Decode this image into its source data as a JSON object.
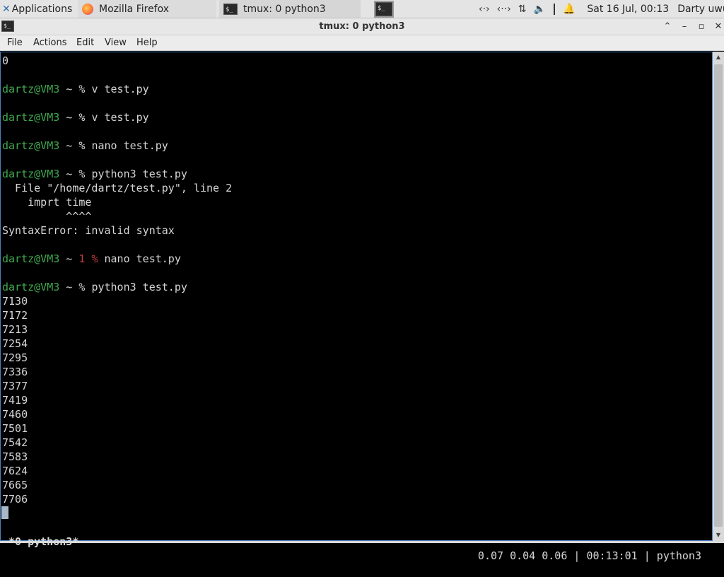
{
  "panel": {
    "applications_label": "Applications",
    "taskbar": [
      {
        "label": "Mozilla Firefox",
        "icon": "firefox-icon"
      },
      {
        "label": "tmux: 0 python3",
        "icon": "terminal-icon"
      }
    ],
    "clock": "Sat 16 Jul, 00:13",
    "user": "Darty uwu"
  },
  "window": {
    "title": "tmux: 0 python3"
  },
  "menu": [
    "File",
    "Actions",
    "Edit",
    "View",
    "Help"
  ],
  "terminal": {
    "colors": {
      "user": "#3fa84f",
      "error": "#c43c3c",
      "text": "#d6d6d6"
    },
    "lines": [
      {
        "plain": "0"
      },
      {
        "plain": ""
      },
      {
        "user": "dartz@VM3",
        "prompt": " ~ % ",
        "cmd": "v test.py"
      },
      {
        "plain": ""
      },
      {
        "user": "dartz@VM3",
        "prompt": " ~ % ",
        "cmd": "v test.py"
      },
      {
        "plain": ""
      },
      {
        "user": "dartz@VM3",
        "prompt": " ~ % ",
        "cmd": "nano test.py"
      },
      {
        "plain": ""
      },
      {
        "user": "dartz@VM3",
        "prompt": " ~ % ",
        "cmd": "python3 test.py"
      },
      {
        "plain": "  File \"/home/dartz/test.py\", line 2"
      },
      {
        "plain": "    imprt time"
      },
      {
        "plain": "          ^^^^"
      },
      {
        "plain": "SyntaxError: invalid syntax"
      },
      {
        "plain": ""
      },
      {
        "user": "dartz@VM3",
        "prompt": " ~ ",
        "err": "1 %",
        "cmd": " nano test.py"
      },
      {
        "plain": ""
      },
      {
        "user": "dartz@VM3",
        "prompt": " ~ % ",
        "cmd": "python3 test.py"
      },
      {
        "plain": "7130"
      },
      {
        "plain": "7172"
      },
      {
        "plain": "7213"
      },
      {
        "plain": "7254"
      },
      {
        "plain": "7295"
      },
      {
        "plain": "7336"
      },
      {
        "plain": "7377"
      },
      {
        "plain": "7419"
      },
      {
        "plain": "7460"
      },
      {
        "plain": "7501"
      },
      {
        "plain": "7542"
      },
      {
        "plain": "7583"
      },
      {
        "plain": "7624"
      },
      {
        "plain": "7665"
      },
      {
        "plain": "7706"
      }
    ],
    "status_left": "*0 python3*",
    "status_right": "0.07 0.04 0.06 | 00:13:01 | python3"
  }
}
